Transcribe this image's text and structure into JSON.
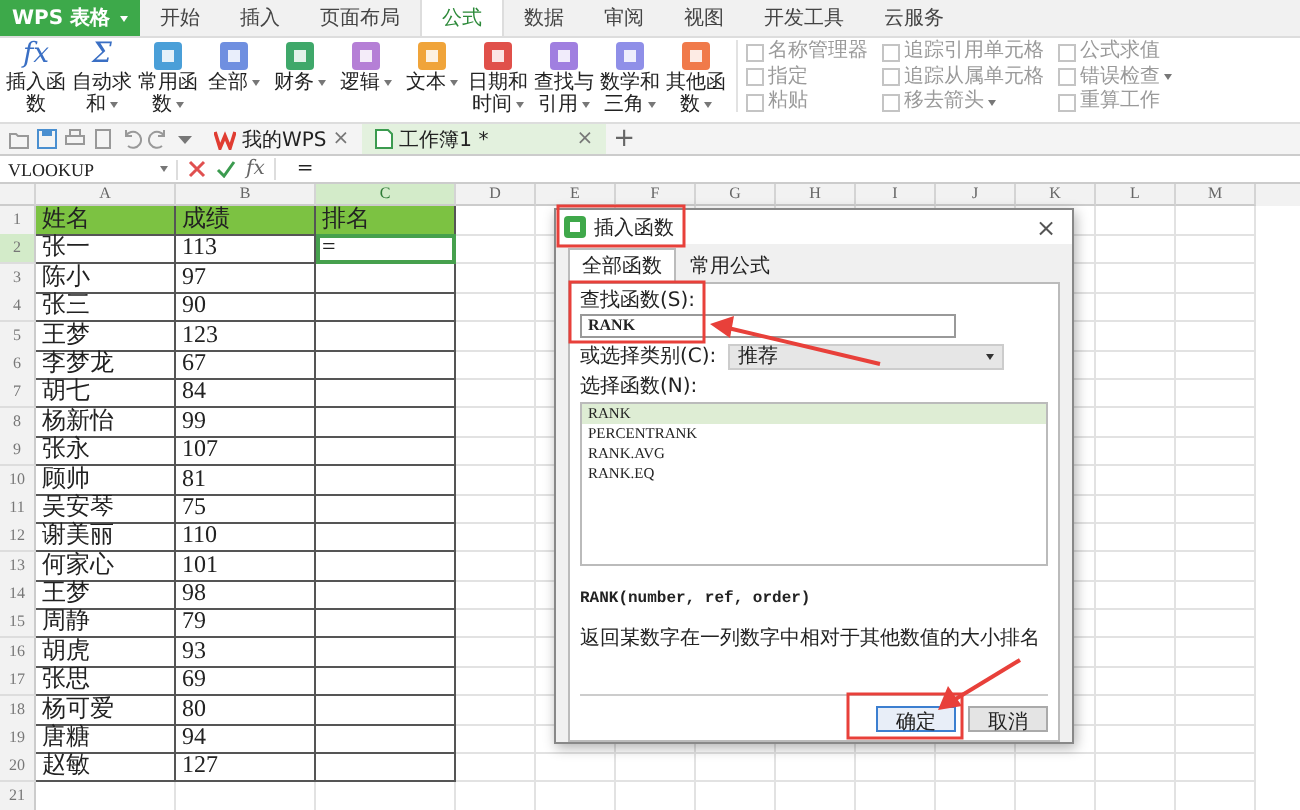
{
  "app_menu": {
    "label": "WPS 表格"
  },
  "menu_tabs": [
    {
      "label": "开始",
      "selected": false
    },
    {
      "label": "插入",
      "selected": false
    },
    {
      "label": "页面布局",
      "selected": false
    },
    {
      "label": "公式",
      "selected": true
    },
    {
      "label": "数据",
      "selected": false
    },
    {
      "label": "审阅",
      "selected": false
    },
    {
      "label": "视图",
      "selected": false
    },
    {
      "label": "开发工具",
      "selected": false
    },
    {
      "label": "云服务",
      "selected": false
    }
  ],
  "ribbon": {
    "groups": [
      {
        "kind": "symbol",
        "symbol": "fx",
        "label": "插入函数",
        "dropdown": false
      },
      {
        "kind": "symbol",
        "symbol": "Σ",
        "label": "自动求和",
        "dropdown": true
      },
      {
        "kind": "category",
        "color": "#4a9fd8",
        "label": "常用函数",
        "dropdown": true
      },
      {
        "kind": "category",
        "color": "#6f8fe0",
        "label": "全部",
        "dropdown": true
      },
      {
        "kind": "category",
        "color": "#3fa86a",
        "label": "财务",
        "dropdown": true
      },
      {
        "kind": "category",
        "color": "#b57fd6",
        "label": "逻辑",
        "dropdown": true
      },
      {
        "kind": "category",
        "color": "#f0a43a",
        "label": "文本",
        "dropdown": true
      },
      {
        "kind": "category",
        "color": "#e0504a",
        "label": "日期和时间",
        "dropdown": true
      },
      {
        "kind": "category",
        "color": "#a07fe0",
        "label": "查找与引用",
        "dropdown": true
      },
      {
        "kind": "category",
        "color": "#8f8fe8",
        "label": "数学和三角",
        "dropdown": true
      },
      {
        "kind": "category",
        "color": "#f07a4a",
        "label": "其他函数",
        "dropdown": true
      }
    ],
    "tool_columns": [
      [
        {
          "label": "名称管理器",
          "dropdown": false
        },
        {
          "label": "指定",
          "dropdown": false
        },
        {
          "label": "粘贴",
          "dropdown": false
        }
      ],
      [
        {
          "label": "追踪引用单元格",
          "dropdown": false
        },
        {
          "label": "追踪从属单元格",
          "dropdown": false
        },
        {
          "label": "移去箭头",
          "dropdown": true
        }
      ],
      [
        {
          "label": "公式求值",
          "dropdown": false
        },
        {
          "label": "错误检查",
          "dropdown": true
        },
        {
          "label": "重算工作",
          "dropdown": false
        }
      ]
    ]
  },
  "doc_tabs": [
    {
      "label": "我的WPS",
      "kind": "home",
      "selected": false,
      "close": "×"
    },
    {
      "label": "工作簿1 *",
      "kind": "workbook",
      "selected": true,
      "close": "×"
    }
  ],
  "new_tab": "+",
  "formula_bar": {
    "name_box": "VLOOKUP",
    "fx": "fx",
    "formula": "="
  },
  "sheet": {
    "columns": [
      "A",
      "B",
      "C",
      "D",
      "E",
      "F",
      "G",
      "H",
      "I",
      "J",
      "K",
      "L",
      "M"
    ],
    "rows": [
      {
        "number": "1",
        "kind": "header",
        "cells": [
          {
            "text": "姓名",
            "selected": false
          },
          {
            "text": "成绩",
            "selected": false
          },
          {
            "text": "排名",
            "selected": false
          }
        ]
      },
      {
        "number": "2",
        "kind": "data",
        "cells": [
          {
            "text": "张一",
            "selected": false
          },
          {
            "text": "113",
            "selected": false
          },
          {
            "text": "=",
            "selected": true
          }
        ]
      },
      {
        "number": "3",
        "kind": "data",
        "cells": [
          {
            "text": "陈小",
            "selected": false
          },
          {
            "text": "97",
            "selected": false
          }
        ]
      },
      {
        "number": "4",
        "kind": "data",
        "cells": [
          {
            "text": "张三",
            "selected": false
          },
          {
            "text": "90",
            "selected": false
          }
        ]
      },
      {
        "number": "5",
        "kind": "data",
        "cells": [
          {
            "text": "王梦",
            "selected": false
          },
          {
            "text": "123",
            "selected": false
          }
        ]
      },
      {
        "number": "6",
        "kind": "data",
        "cells": [
          {
            "text": "李梦龙",
            "selected": false
          },
          {
            "text": "67",
            "selected": false
          }
        ]
      },
      {
        "number": "7",
        "kind": "data",
        "cells": [
          {
            "text": "胡七",
            "selected": false
          },
          {
            "text": "84",
            "selected": false
          }
        ]
      },
      {
        "number": "8",
        "kind": "data",
        "cells": [
          {
            "text": "杨新怡",
            "selected": false
          },
          {
            "text": "99",
            "selected": false
          }
        ]
      },
      {
        "number": "9",
        "kind": "data",
        "cells": [
          {
            "text": "张永",
            "selected": false
          },
          {
            "text": "107",
            "selected": false
          }
        ]
      },
      {
        "number": "10",
        "kind": "data",
        "cells": [
          {
            "text": "顾帅",
            "selected": false
          },
          {
            "text": "81",
            "selected": false
          }
        ]
      },
      {
        "number": "11",
        "kind": "data",
        "cells": [
          {
            "text": "吴安琴",
            "selected": false
          },
          {
            "text": "75",
            "selected": false
          }
        ]
      },
      {
        "number": "12",
        "kind": "data",
        "cells": [
          {
            "text": "谢美丽",
            "selected": false
          },
          {
            "text": "110",
            "selected": false
          }
        ]
      },
      {
        "number": "13",
        "kind": "data",
        "cells": [
          {
            "text": "何家心",
            "selected": false
          },
          {
            "text": "101",
            "selected": false
          }
        ]
      },
      {
        "number": "14",
        "kind": "data",
        "cells": [
          {
            "text": "王梦",
            "selected": false
          },
          {
            "text": "98",
            "selected": false
          }
        ]
      },
      {
        "number": "15",
        "kind": "data",
        "cells": [
          {
            "text": "周静",
            "selected": false
          },
          {
            "text": "79",
            "selected": false
          }
        ]
      },
      {
        "number": "16",
        "kind": "data",
        "cells": [
          {
            "text": "胡虎",
            "selected": false
          },
          {
            "text": "93",
            "selected": false
          }
        ]
      },
      {
        "number": "17",
        "kind": "data",
        "cells": [
          {
            "text": "张思",
            "selected": false
          },
          {
            "text": "69",
            "selected": false
          }
        ]
      },
      {
        "number": "18",
        "kind": "data",
        "cells": [
          {
            "text": "杨可爱",
            "selected": false
          },
          {
            "text": "80",
            "selected": false
          }
        ]
      },
      {
        "number": "19",
        "kind": "data",
        "cells": [
          {
            "text": "唐糖",
            "selected": false
          },
          {
            "text": "94",
            "selected": false
          }
        ]
      },
      {
        "number": "20",
        "kind": "data",
        "cells": [
          {
            "text": "赵敏",
            "selected": false
          },
          {
            "text": "127",
            "selected": false
          }
        ]
      },
      {
        "number": "21",
        "kind": "empty"
      }
    ]
  },
  "dialog": {
    "title": "插入函数",
    "close": "×",
    "tabs": [
      {
        "label": "全部函数",
        "selected": true
      },
      {
        "label": "常用公式",
        "selected": false
      }
    ],
    "search": {
      "label": "查找函数(S):",
      "value": "RANK"
    },
    "category": {
      "label": "或选择类别(C):",
      "value": "推荐"
    },
    "functions": {
      "label": "选择函数(N):",
      "items": [
        {
          "label": "RANK",
          "selected": true
        },
        {
          "label": "PERCENTRANK",
          "selected": false
        },
        {
          "label": "RANK.AVG",
          "selected": false
        },
        {
          "label": "RANK.EQ",
          "selected": false
        }
      ]
    },
    "syntax": "RANK(number, ref, order)",
    "description": "返回某数字在一列数字中相对于其他数值的大小排名",
    "buttons": [
      {
        "label": "确定",
        "kind": "primary"
      },
      {
        "label": "取消",
        "kind": "secondary"
      }
    ]
  }
}
